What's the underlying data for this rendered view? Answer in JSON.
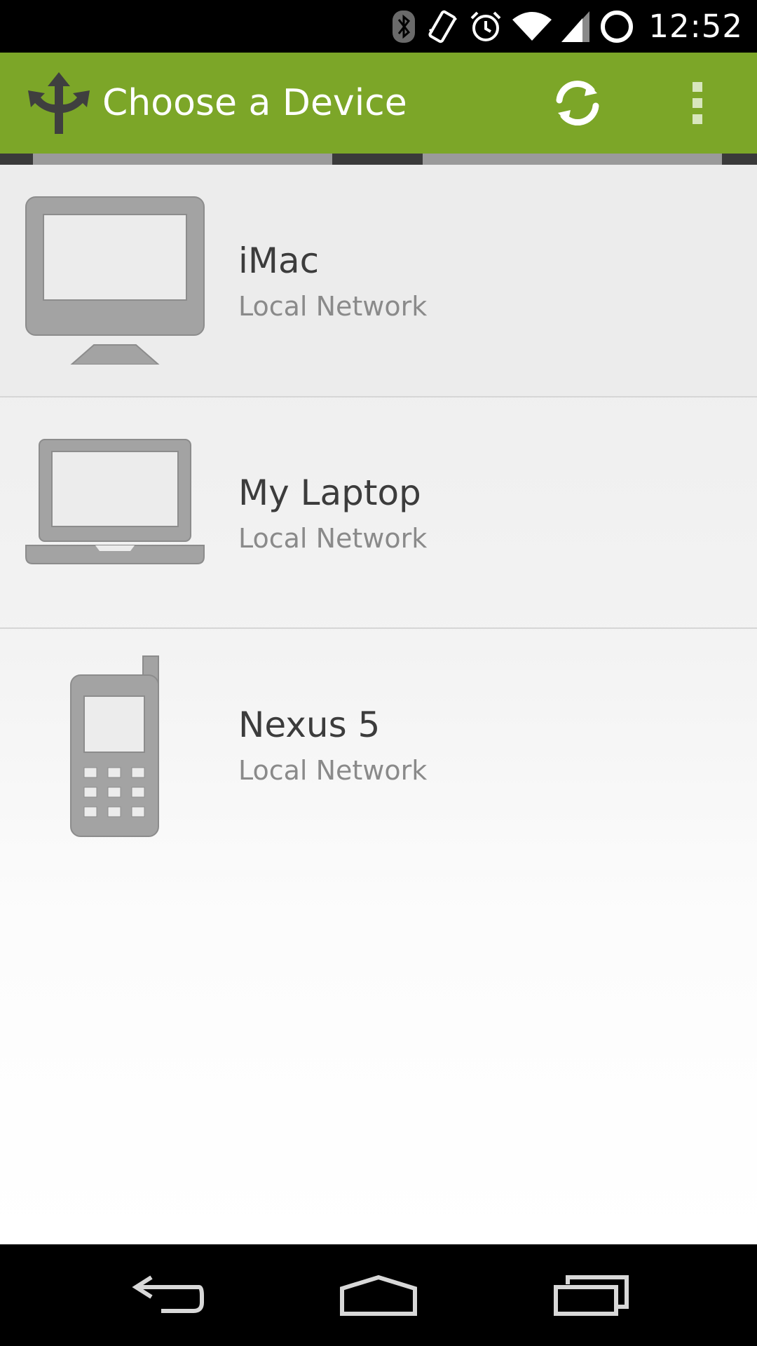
{
  "status_bar": {
    "time": "12:52",
    "icons": [
      "bluetooth-icon",
      "vibrate-icon",
      "alarm-icon",
      "wifi-icon",
      "signal-icon",
      "battery-icon"
    ]
  },
  "action_bar": {
    "title": "Choose a Device",
    "app_icon": "three-way-arrow-icon",
    "actions": [
      "refresh-icon",
      "overflow-menu-icon"
    ],
    "background_color": "#7ca628"
  },
  "devices": [
    {
      "name": "iMac",
      "subtitle": "Local Network",
      "icon": "desktop-monitor-icon"
    },
    {
      "name": "My Laptop",
      "subtitle": "Local Network",
      "icon": "laptop-icon"
    },
    {
      "name": "Nexus 5",
      "subtitle": "Local Network",
      "icon": "mobile-phone-icon"
    }
  ],
  "nav_bar": {
    "buttons": [
      "back-icon",
      "home-icon",
      "recents-icon"
    ]
  }
}
